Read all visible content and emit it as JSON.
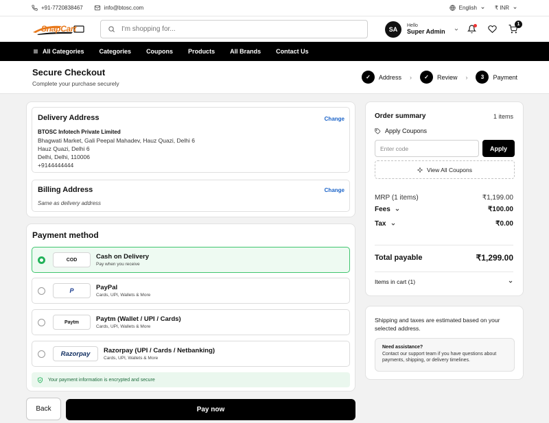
{
  "topbar": {
    "phone": "+91-7720838467",
    "email": "info@btosc.com",
    "language": "English",
    "currency": "₹ INR"
  },
  "header": {
    "logo_text": "SnapCart",
    "search_placeholder": "I'm shopping for...",
    "user_initials": "SA",
    "user_greeting": "Hello",
    "user_name": "Super Admin",
    "cart_count": "1"
  },
  "nav": {
    "items": [
      "All Categories",
      "Categories",
      "Coupons",
      "Products",
      "All Brands",
      "Contact Us"
    ]
  },
  "checkout": {
    "title": "Secure Checkout",
    "subtitle": "Complete your purchase securely",
    "steps": [
      {
        "label": "Address",
        "marker": "✓"
      },
      {
        "label": "Review",
        "marker": "✓"
      },
      {
        "label": "Payment",
        "marker": "3"
      }
    ]
  },
  "delivery": {
    "title": "Delivery Address",
    "change_label": "Change",
    "company": "BTOSC Infotech Private Limited",
    "line1": "Bhagwati Market, Gali Peepal Mahadev, Hauz Quazi, Delhi 6",
    "line2": "Hauz Quazi, Delhi 6",
    "line3": "Delhi, Delhi, 110006",
    "phone": "+9144444444"
  },
  "billing": {
    "title": "Billing Address",
    "change_label": "Change",
    "note": "Same as delivery address"
  },
  "payment": {
    "title": "Payment method",
    "methods": [
      {
        "logo": "COD",
        "title": "Cash on Delivery",
        "sub": "Pay when you receive",
        "selected": true
      },
      {
        "logo": "P",
        "title": "PayPal",
        "sub": "Cards, UPI, Wallets & More",
        "selected": false
      },
      {
        "logo": "Paytm",
        "title": "Paytm (Wallet / UPI / Cards)",
        "sub": "Cards, UPI, Wallets & More",
        "selected": false
      },
      {
        "logo": "Razorpay",
        "title": "Razorpay (UPI / Cards / Netbanking)",
        "sub": "Cards, UPI, Wallets & More",
        "selected": false
      }
    ],
    "secure_note": "Your payment information is encrypted and secure"
  },
  "actions": {
    "back_label": "Back",
    "pay_label": "Pay now"
  },
  "summary": {
    "title": "Order summary",
    "items_count": "1 items",
    "apply_coupons": "Apply Coupons",
    "code_placeholder": "Enter code",
    "apply_label": "Apply",
    "view_coupons": "View All Coupons",
    "mrp_label": "MRP (1 items)",
    "mrp_value": "₹1,199.00",
    "fees_label": "Fees",
    "fees_value": "₹100.00",
    "tax_label": "Tax",
    "tax_value": "₹0.00",
    "total_label": "Total payable",
    "total_value": "₹1,299.00",
    "items_in_cart": "Items in cart (1)"
  },
  "info": {
    "shipping_note": "Shipping and taxes are estimated based on your selected address.",
    "help_title": "Need assistance?",
    "help_text": "Contact our support team if you have questions about payments, shipping, or delivery timelines."
  },
  "colors": {
    "accent_green": "#22b25a",
    "link_blue": "#1a63c8",
    "brand_orange": "#e8781a"
  }
}
